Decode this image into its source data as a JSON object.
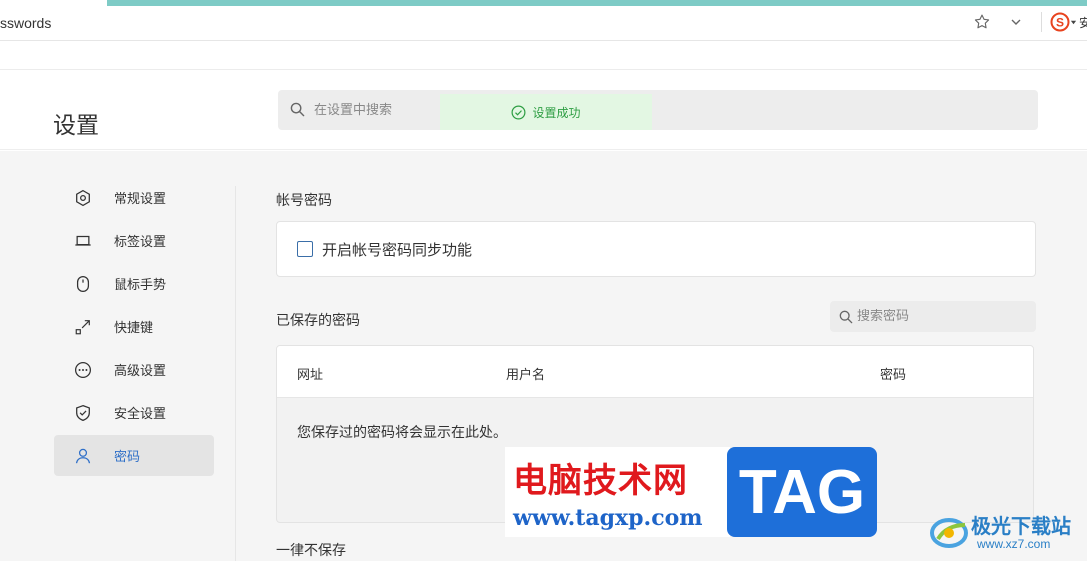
{
  "tabbar": {
    "title": "sswords",
    "sogou_trailing_text": "安"
  },
  "header": {
    "title": "设置",
    "search_placeholder": "在设置中搜索",
    "toast_text": "设置成功"
  },
  "sidebar": {
    "items": [
      {
        "label": "常规设置",
        "icon": "hexagon-settings-icon"
      },
      {
        "label": "标签设置",
        "icon": "tab-icon"
      },
      {
        "label": "鼠标手势",
        "icon": "mouse-icon"
      },
      {
        "label": "快捷键",
        "icon": "shortcut-arrow-icon"
      },
      {
        "label": "高级设置",
        "icon": "more-circle-icon"
      },
      {
        "label": "安全设置",
        "icon": "shield-icon"
      },
      {
        "label": "密码",
        "icon": "user-icon",
        "active": true
      }
    ]
  },
  "account": {
    "section_title": "帐号密码",
    "sync_label": "开启帐号密码同步功能",
    "sync_checked": false
  },
  "saved": {
    "section_title": "已保存的密码",
    "search_placeholder": "搜索密码",
    "columns": [
      "网址",
      "用户名",
      "密码"
    ],
    "empty_message": "您保存过的密码将会显示在此处。"
  },
  "never_save": {
    "section_title": "一律不保存"
  },
  "watermarks": {
    "site_cn": "电脑技术网",
    "site_url": "www.tagxp.com",
    "tag_text": "TAG",
    "right_cn": "极光下载站",
    "right_url": "www.xz7.com"
  },
  "colors": {
    "accent_blue": "#2e6fc8",
    "success_green": "#2e9e43",
    "top_accent": "#7ecbc6"
  }
}
